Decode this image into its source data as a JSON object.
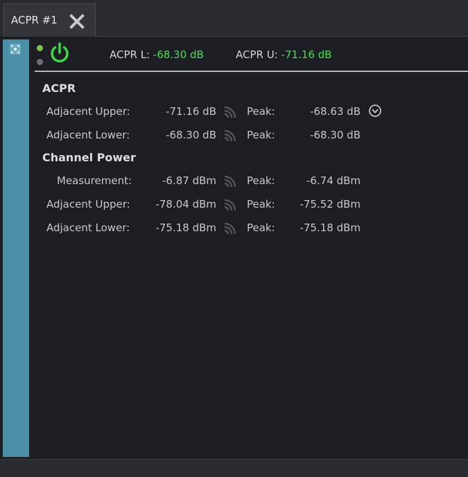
{
  "tab": {
    "label": "ACPR #1"
  },
  "summary": {
    "acpr_l_label": "ACPR L:",
    "acpr_l_value": "-68.30 dB",
    "acpr_u_label": "ACPR U:",
    "acpr_u_value": "-71.16 dB"
  },
  "colors": {
    "accent_green": "#47e24a",
    "sidebar": "#4a8fa6"
  },
  "acpr": {
    "title": "ACPR",
    "rows": [
      {
        "label": "Adjacent Upper:",
        "value": "-71.16 dB",
        "peak_label": "Peak:",
        "peak_value": "-68.63 dB"
      },
      {
        "label": "Adjacent Lower:",
        "value": "-68.30 dB",
        "peak_label": "Peak:",
        "peak_value": "-68.30 dB"
      }
    ]
  },
  "channel_power": {
    "title": "Channel Power",
    "rows": [
      {
        "label": "Measurement:",
        "value": "-6.87 dBm",
        "peak_label": "Peak:",
        "peak_value": "-6.74 dBm"
      },
      {
        "label": "Adjacent Upper:",
        "value": "-78.04 dBm",
        "peak_label": "Peak:",
        "peak_value": "-75.52 dBm"
      },
      {
        "label": "Adjacent Lower:",
        "value": "-75.18 dBm",
        "peak_label": "Peak:",
        "peak_value": "-75.18 dBm"
      }
    ]
  },
  "icons": {
    "tab_close": "close-icon",
    "sidebar": "expand-window-icon",
    "power": "power-icon",
    "signal": "signal-icon",
    "row_expand": "chevron-circle-icon"
  }
}
